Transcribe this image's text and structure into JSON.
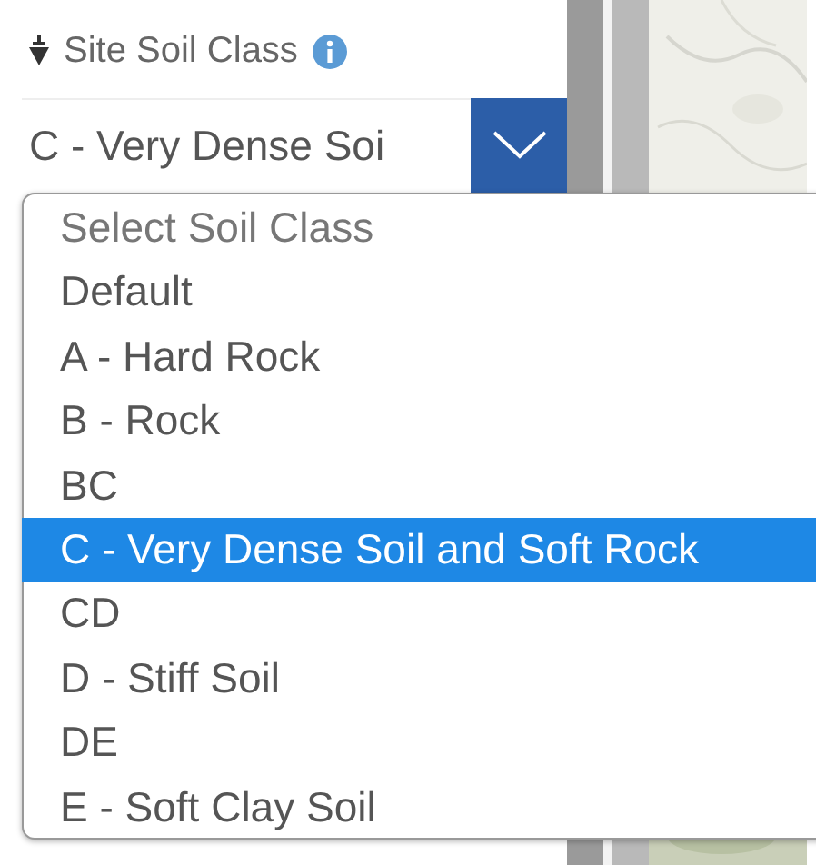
{
  "field": {
    "label": "Site Soil Class",
    "value": "C - Very Dense Soi"
  },
  "dropdown": {
    "options": [
      {
        "label": "Select Soil Class",
        "selected": false,
        "kind": "placeholder"
      },
      {
        "label": "Default",
        "selected": false,
        "kind": "option"
      },
      {
        "label": "A - Hard Rock",
        "selected": false,
        "kind": "option"
      },
      {
        "label": "B - Rock",
        "selected": false,
        "kind": "option"
      },
      {
        "label": "BC",
        "selected": false,
        "kind": "option"
      },
      {
        "label": "C - Very Dense Soil and Soft Rock",
        "selected": true,
        "kind": "option"
      },
      {
        "label": "CD",
        "selected": false,
        "kind": "option"
      },
      {
        "label": "D - Stiff Soil",
        "selected": false,
        "kind": "option"
      },
      {
        "label": "DE",
        "selected": false,
        "kind": "option"
      },
      {
        "label": "E - Soft Clay Soil",
        "selected": false,
        "kind": "option"
      }
    ]
  }
}
